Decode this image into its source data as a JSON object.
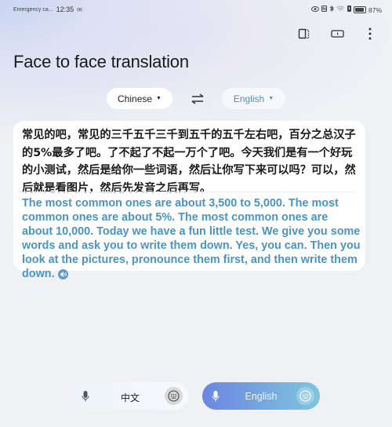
{
  "status_bar": {
    "carrier": "Emergency ca...",
    "time": "12:35",
    "notification_icon": "mail-icon",
    "icons": [
      "eye-icon",
      "nfc-icon",
      "bluetooth-icon",
      "wifi-icon",
      "vibrate-icon"
    ],
    "battery_percent": 87,
    "battery_label": "87%"
  },
  "toolbar": {
    "icons": [
      "split-screen-icon",
      "landscape-mode-icon",
      "more-options-icon"
    ]
  },
  "header": {
    "title": "Face to face translation"
  },
  "languages": {
    "source": "Chinese",
    "target": "English",
    "swap_icon": "swap-arrows-icon"
  },
  "translation": {
    "source_text": "常见的吧，常见的三千五千三千到五千的五千左右吧，百分之总汉子的5%最多了吧。了不起了不起一万个了吧。今天我们是有一个好玩的小测试，然后是给你一些词语，然后让你写下来可以吗？可以，然后就是看图片，然后先发音之后再写。",
    "target_text": "The most common ones are about 3,500 to 5,000. The most common ones are about 5%. The most common ones are about 10,000. Today we have a fun little test. We give you some words and ask you to write them down. Yes, you can. Then you look at the pictures, pronounce them first, and then write them down.",
    "speaker_icon": "speaker-icon"
  },
  "bottom_bar": {
    "chinese_button_label": "中文",
    "english_button_label": "English",
    "mic_icon": "microphone-icon",
    "keyboard_icon": "keyboard-icon"
  },
  "colors": {
    "accent_blue": "#4a95c6",
    "english_pill_start": "#6a86e3",
    "english_pill_end": "#7dc6dc"
  }
}
